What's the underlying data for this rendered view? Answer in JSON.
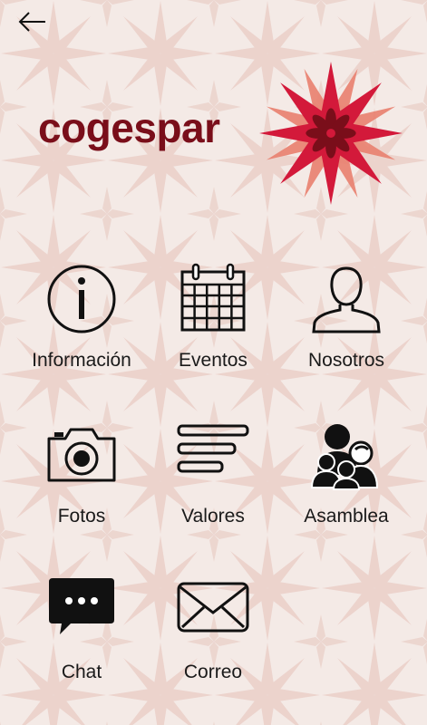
{
  "app": {
    "logo_text": "cogespar"
  },
  "menu": [
    {
      "key": "informacion",
      "label": "Información",
      "icon": "info-icon"
    },
    {
      "key": "eventos",
      "label": "Eventos",
      "icon": "calendar-icon"
    },
    {
      "key": "nosotros",
      "label": "Nosotros",
      "icon": "person-icon"
    },
    {
      "key": "fotos",
      "label": "Fotos",
      "icon": "camera-icon"
    },
    {
      "key": "valores",
      "label": "Valores",
      "icon": "list-icon"
    },
    {
      "key": "asamblea",
      "label": "Asamblea",
      "icon": "group-icon"
    },
    {
      "key": "chat",
      "label": "Chat",
      "icon": "chat-bubble-icon"
    },
    {
      "key": "correo",
      "label": "Correo",
      "icon": "envelope-icon"
    }
  ],
  "colors": {
    "brand_dark_red": "#7a0e1a",
    "brand_red": "#d3193a",
    "brand_salmon": "#e9806f",
    "background": "#f1e6e2",
    "icon": "#111111"
  }
}
